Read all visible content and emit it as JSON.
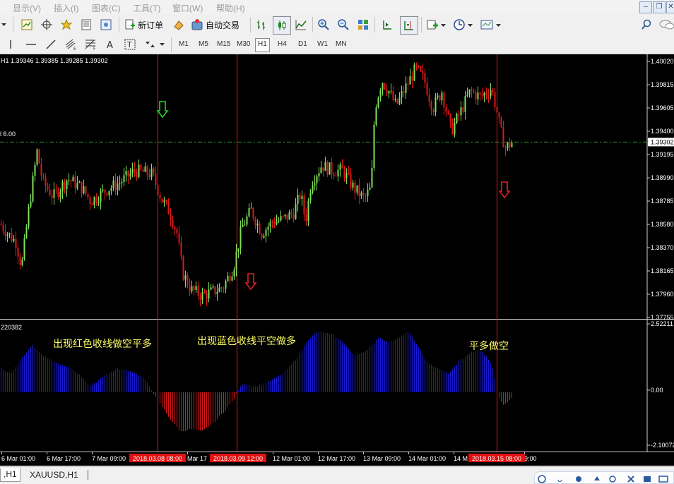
{
  "menu": [
    "显示(V)",
    "插入(I)",
    "图表(C)",
    "工具(T)",
    "窗口(W)",
    "帮助(H)"
  ],
  "toolbar": {
    "new_order_label": "新订单",
    "auto_trade_label": "自动交易"
  },
  "timeframes": [
    "M1",
    "M5",
    "M15",
    "M30",
    "H1",
    "H4",
    "D1",
    "W1",
    "MN"
  ],
  "active_timeframe": "H1",
  "chart": {
    "header_prefix": "H1",
    "ohlc": "1.39346 1.39385 1.39285 1.39302",
    "hline_label": "l 6.00",
    "indicator_label": "220382",
    "current_price": "1.39302",
    "price_axis": [
      "1.40020",
      "1.39815",
      "1.39605",
      "1.39400",
      "1.39195",
      "1.38990",
      "1.38785",
      "1.38580",
      "1.38370",
      "1.38165",
      "1.37960",
      "1.37755"
    ],
    "indicator_axis": [
      "2.52211",
      "0.00",
      "-2.10072"
    ],
    "time_axis": [
      "6 Mar 01:00",
      "6 Mar 17:00",
      "7 Mar 09:00",
      "Mar 17",
      "12 Mar 01:00",
      "12 Mar 17:00",
      "13 Mar 09:00",
      "14 Mar 01:00",
      "14 M",
      "9:00"
    ],
    "highlight_times": [
      "2018.03.08 08:00",
      "2018.03.09 12:00",
      "2018.03.15 08:00"
    ],
    "annotations": {
      "red": "出现红色收线做空平多",
      "blue": "出现蓝色收线平空做多",
      "flat": "平多做空"
    },
    "colors": {
      "bull": "#7fe05a",
      "bear": "#e01818",
      "hist_pos": "#1a1ad8",
      "hist_neg": "#d81818",
      "vline": "#d42020",
      "arrow_up": "#29d229",
      "arrow_down": "#e02020",
      "hline": "#2e9a2e",
      "annotation": "#ffff66"
    }
  },
  "tabs": [
    ",H1",
    "XAUUSD,H1"
  ]
}
